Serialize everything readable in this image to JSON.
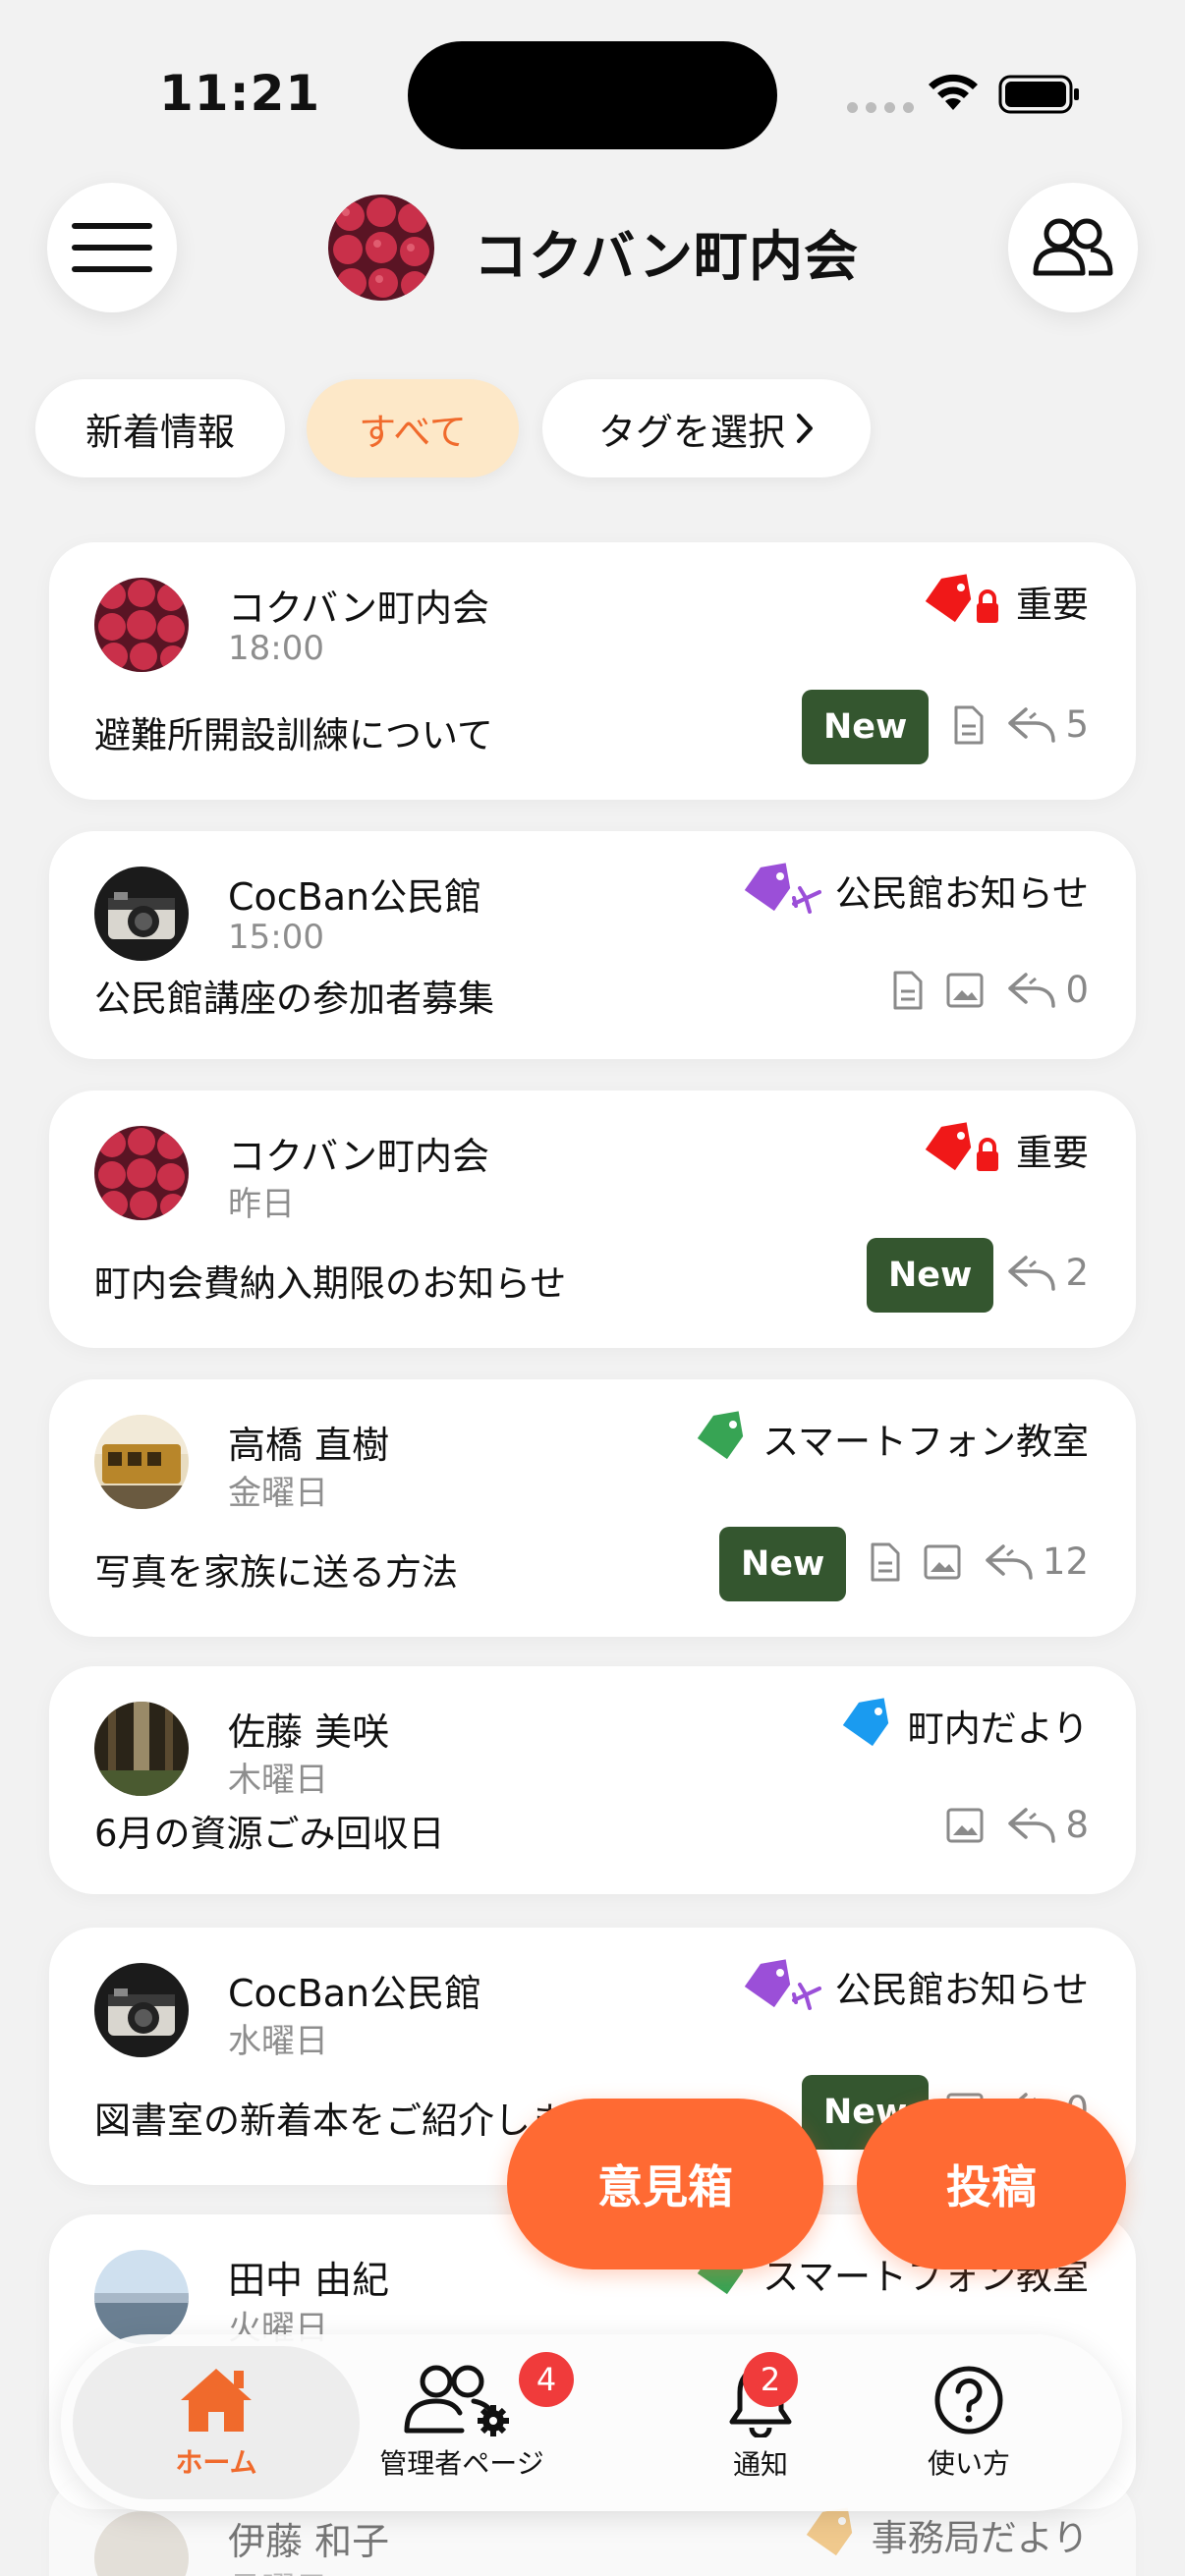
{
  "status": {
    "time": "11:21"
  },
  "header": {
    "title": "コクバン町内会"
  },
  "filters": {
    "latest": "新着情報",
    "all": "すべて",
    "tag_select": "タグを選択"
  },
  "posts": [
    {
      "author": "コクバン町内会",
      "time": "18:00",
      "title": "避難所開設訓練について",
      "tag": "重要",
      "tag_icon": "red-lock-tag",
      "is_new": true,
      "has_doc": true,
      "has_image": false,
      "replies": "5",
      "new_label": "New"
    },
    {
      "author": "CocBan公民館",
      "time": "15:00",
      "title": "公民館講座の参加者募集",
      "tag": "公民館お知らせ",
      "tag_icon": "purple-plane-tag",
      "is_new": false,
      "has_doc": true,
      "has_image": true,
      "replies": "0"
    },
    {
      "author": "コクバン町内会",
      "time": "昨日",
      "title": "町内会費納入期限のお知らせ",
      "tag": "重要",
      "tag_icon": "red-lock-tag",
      "is_new": true,
      "has_doc": false,
      "has_image": false,
      "replies": "2",
      "new_label": "New"
    },
    {
      "author": "高橋 直樹",
      "time": "金曜日",
      "title": "写真を家族に送る方法",
      "tag": "スマートフォン教室",
      "tag_icon": "green-tag",
      "is_new": true,
      "has_doc": true,
      "has_image": true,
      "replies": "12",
      "new_label": "New"
    },
    {
      "author": "佐藤 美咲",
      "time": "木曜日",
      "title": "6月の資源ごみ回収日",
      "tag": "町内だより",
      "tag_icon": "blue-tag",
      "is_new": false,
      "has_doc": false,
      "has_image": true,
      "replies": "8"
    },
    {
      "author": "CocBan公民館",
      "time": "水曜日",
      "title": "図書室の新着本をご紹介します",
      "tag": "公民館お知らせ",
      "tag_icon": "purple-plane-tag",
      "is_new": true,
      "has_doc": false,
      "has_image": true,
      "replies": "0",
      "new_label": "New"
    },
    {
      "author": "田中 由紀",
      "time": "火曜日",
      "title": "",
      "tag": "スマートフォン教室",
      "tag_icon": "green-tag"
    },
    {
      "author": "伊藤 和子",
      "time": "月曜日",
      "title": "",
      "tag": "事務局だより",
      "tag_icon": "orange-tag"
    }
  ],
  "actions": {
    "opinion_box": "意見箱",
    "post": "投稿"
  },
  "nav": {
    "home": "ホーム",
    "admin": "管理者ページ",
    "admin_badge": "4",
    "notifications": "通知",
    "notifications_badge": "2",
    "help": "使い方"
  },
  "colors": {
    "accent": "#ff6a33",
    "new_badge": "#34562f",
    "important_red": "#f01818",
    "purple": "#9b4fd8",
    "green": "#37a454",
    "blue": "#1a9bf0"
  }
}
